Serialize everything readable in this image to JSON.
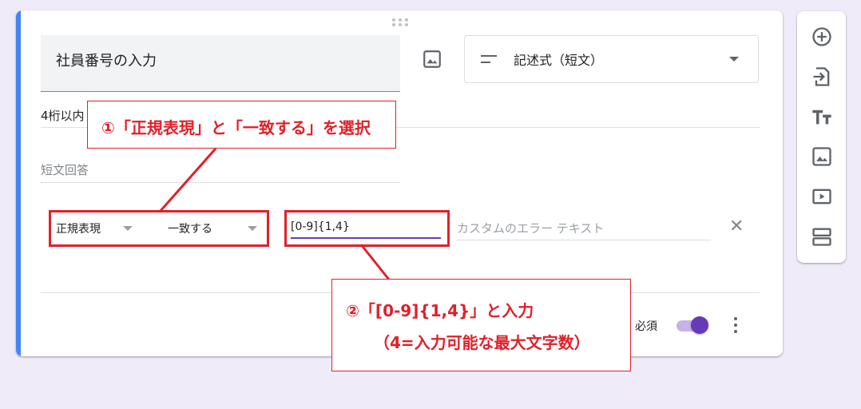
{
  "question": {
    "title": "社員番号の入力",
    "type_label": "記述式（短文）",
    "description_visible": "4桁以内",
    "answer_placeholder": "短文回答"
  },
  "validation": {
    "rule_type": "正規表現",
    "rule_condition": "一致する",
    "pattern_value": "[0-9]{1,4}",
    "error_placeholder": "カスタムのエラー テキスト"
  },
  "footer": {
    "required_label": "必須",
    "required_on": true
  },
  "sidebar": {
    "tools": [
      "add-question-icon",
      "import-questions-icon",
      "add-title-icon",
      "add-image-icon",
      "add-video-icon",
      "add-section-icon"
    ]
  },
  "annotations": {
    "step1": "①「正規表現」と「一致する」を選択",
    "step2_line1": "②「[0-9]{1,4}」と入力",
    "step2_line2": "（4=入力可能な最大文字数）",
    "color": "#e0202a"
  },
  "colors": {
    "accent": "#4285f4",
    "theme": "#673ab7",
    "background": "#f0ebf8"
  }
}
